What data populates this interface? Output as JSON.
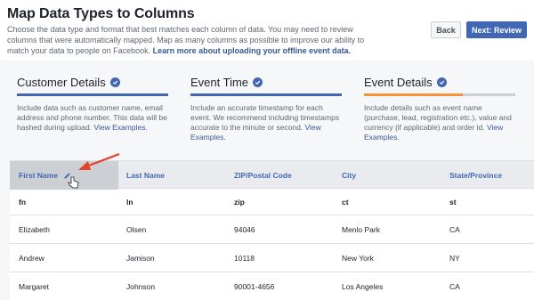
{
  "header": {
    "title": "Map Data Types to Columns",
    "subtitle": "Choose the data type and format that best matches each column of data. You may need to review columns that were automatically mapped. Map as many columns as possible to improve our ability to match your data to people on Facebook.",
    "learn_more": "Learn more about uploading your offline event data.",
    "back_label": "Back",
    "next_label": "Next: Review"
  },
  "steps": [
    {
      "title": "Customer Details",
      "description": "Include data such as customer name, email address and phone number. This data will be hashed during upload.",
      "link": "View Examples.",
      "progress": 1.0,
      "bar_color": "#4267b2"
    },
    {
      "title": "Event Time",
      "description": "Include an accurate timestamp for each event. We recommend including timestamps accurate to the minute or second.",
      "link": "View Examples.",
      "progress": 1.0,
      "bar_color": "#4267b2"
    },
    {
      "title": "Event Details",
      "description": "Include details such as event name (purchase, lead, registration etc.), value and currency (if applicable) and order id.",
      "link": "View Examples.",
      "progress": 0.65,
      "bar_color": "#f7923b"
    }
  ],
  "table": {
    "columns": [
      "First Name",
      "Last Name",
      "ZIP/Postal Code",
      "City",
      "State/Province"
    ],
    "format_row": [
      "fn",
      "ln",
      "zip",
      "ct",
      "st"
    ],
    "rows": [
      [
        "Elizabeth",
        "Olsen",
        "94046",
        "Menlo Park",
        "CA"
      ],
      [
        "Andrew",
        "Jamison",
        "10118",
        "New York",
        "NY"
      ],
      [
        "Margaret",
        "Johnson",
        "90001-4656",
        "Los Angeles",
        "CA"
      ]
    ]
  },
  "colors": {
    "accent": "#4267b2",
    "highlight": "#f7923b",
    "annotation": "#e5402a"
  },
  "icons": {
    "step_check": "check-circle-icon",
    "column_edit": "pencil-icon",
    "cursor": "hand-pointer-icon",
    "annotation": "red-arrow"
  }
}
